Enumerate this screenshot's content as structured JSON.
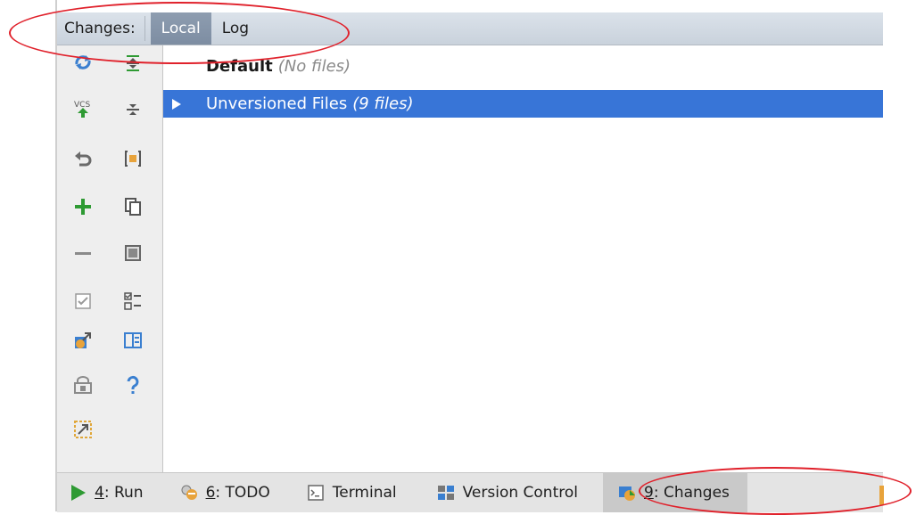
{
  "header": {
    "caption": "Changes:",
    "tabs": [
      {
        "label": "Local",
        "active": true
      },
      {
        "label": "Log",
        "active": false
      }
    ]
  },
  "tree": {
    "rows": [
      {
        "name": "Default",
        "count": "(No files)",
        "selected": false,
        "bold": true
      },
      {
        "name": "Unversioned Files",
        "count": "(9 files)",
        "selected": true,
        "bold": false
      }
    ]
  },
  "toolbar": {
    "left_column_icons": [
      "refresh-icon",
      "vcs-commit-icon",
      "rollback-icon",
      "add-icon",
      "remove-icon",
      "checkbox-icon",
      "move-to-changelist-icon",
      "shelve-icon",
      "shrink-icon"
    ],
    "right_column_icons": [
      "expand-all-icon",
      "collapse-all-icon",
      "group-by-icon",
      "copy-icon",
      "preview-icon",
      "show-details-icon",
      "diff-panel-icon",
      "help-icon"
    ]
  },
  "bottom_bar": {
    "items": [
      {
        "key": "4",
        "label": ": Run",
        "icon": "run-icon",
        "active": false
      },
      {
        "key": "6",
        "label": ": TODO",
        "icon": "todo-icon",
        "active": false
      },
      {
        "key": "",
        "label": "Terminal",
        "icon": "terminal-icon",
        "active": false
      },
      {
        "key": "",
        "label": "Version Control",
        "icon": "version-control-icon",
        "active": false
      },
      {
        "key": "9",
        "label": ": Changes",
        "icon": "changes-icon",
        "active": true
      }
    ]
  },
  "colors": {
    "selection": "#3875d7",
    "annotation": "#e0212b",
    "active_tab": "#8293a8"
  }
}
